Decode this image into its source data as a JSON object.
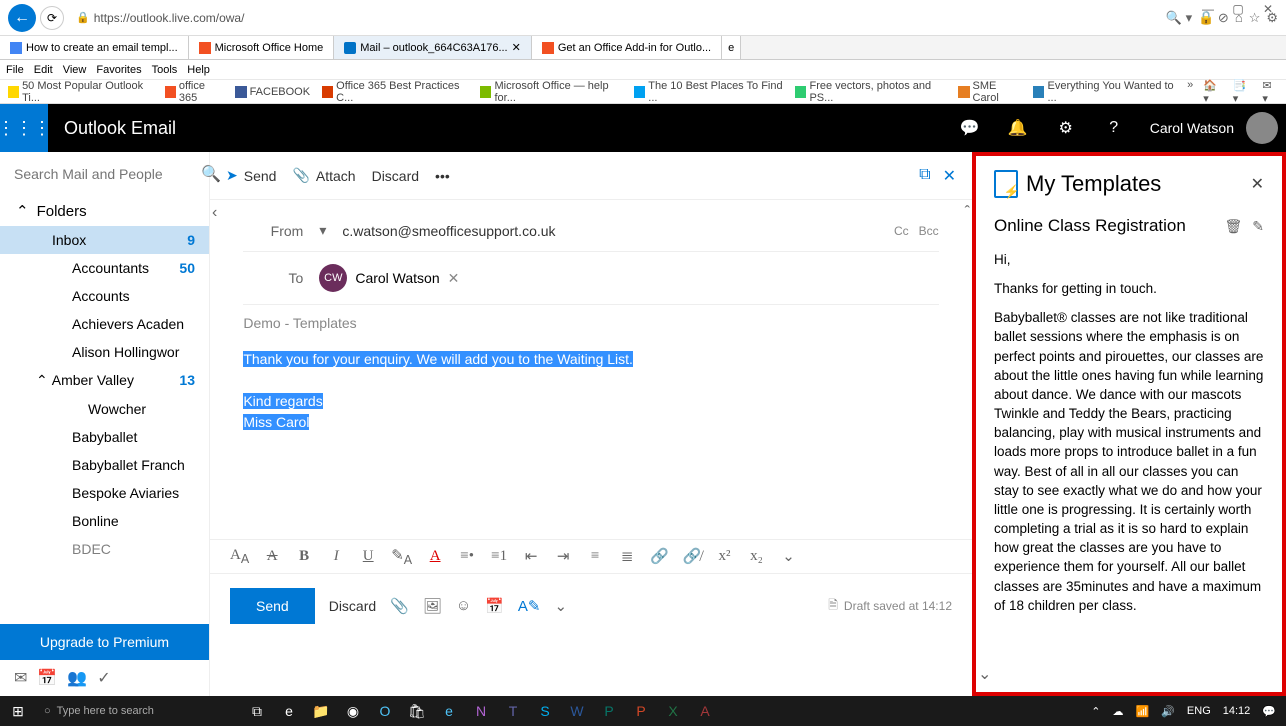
{
  "browser": {
    "url": "https://outlook.live.com/owa/",
    "menus": [
      "File",
      "Edit",
      "View",
      "Favorites",
      "Tools",
      "Help"
    ],
    "tabs": [
      {
        "label": "How to create an email templ..."
      },
      {
        "label": "Microsoft Office Home"
      },
      {
        "label": "Mail – outlook_664C63A176..."
      },
      {
        "label": "Get an Office Add-in for Outlo..."
      }
    ],
    "bookmarks": [
      "50 Most Popular Outlook Ti...",
      "office 365",
      "FACEBOOK",
      "Office 365 Best Practices  C...",
      "Microsoft Office — help for...",
      "The 10 Best Places To Find ...",
      "Free vectors, photos and PS...",
      "SME Carol",
      "Everything You Wanted to ..."
    ]
  },
  "header": {
    "app_title": "Outlook Email",
    "user": "Carol Watson"
  },
  "nav": {
    "search_placeholder": "Search Mail and People",
    "folders_label": "Folders",
    "folders": [
      {
        "name": "Inbox",
        "count": "9",
        "selected": true,
        "indent": 1
      },
      {
        "name": "Accountants",
        "count": "50",
        "indent": 2
      },
      {
        "name": "Accounts",
        "count": "",
        "indent": 2
      },
      {
        "name": "Achievers Academy",
        "count": "",
        "indent": 2,
        "truncated": "Achievers Acaden"
      },
      {
        "name": "Alison Hollingwor",
        "count": "",
        "indent": 2
      },
      {
        "name": "Amber Valley",
        "count": "13",
        "indent": 2,
        "expandable": true
      },
      {
        "name": "Wowcher",
        "count": "",
        "indent": 3
      },
      {
        "name": "Babyballet",
        "count": "",
        "indent": 2
      },
      {
        "name": "Babyballet Franch",
        "count": "",
        "indent": 2
      },
      {
        "name": "Bespoke Aviaries",
        "count": "",
        "indent": 2
      },
      {
        "name": "Bonline",
        "count": "",
        "indent": 2
      },
      {
        "name": "BDEC",
        "count": "",
        "indent": 2
      }
    ],
    "upgrade": "Upgrade to Premium"
  },
  "compose": {
    "send": "Send",
    "attach": "Attach",
    "discard": "Discard",
    "from_label": "From",
    "from_value": "c.watson@smeofficesupport.co.uk",
    "to_label": "To",
    "cc": "Cc",
    "bcc": "Bcc",
    "recipient_name": "Carol Watson",
    "recipient_initials": "CW",
    "subject": "Demo - Templates",
    "body_line1": "Thank you for your enquiry.  We will add you to the Waiting List.",
    "body_line2": "Kind regards",
    "body_line3": "Miss Carol",
    "send_button": "Send",
    "discard_button": "Discard",
    "draft_status": "Draft saved at 14:12"
  },
  "templates": {
    "title": "My Templates",
    "item_name": "Online Class Registration",
    "para1": "Hi,",
    "para2": "Thanks for getting in touch.",
    "para3": "Babyballet® classes are not like traditional ballet sessions where the emphasis is on perfect points and pirouettes, our classes are about the little ones having fun while learning about dance.   We dance with our mascots Twinkle and Teddy the Bears, practicing balancing, play with musical instruments and loads more props to introduce ballet in a fun way.  Best of all in all our classes you can stay to see exactly what we do and how your little one is progressing.  It is certainly worth completing a trial as it is so hard to explain how great the classes are you have to experience them for yourself.  All our ballet classes are 35minutes and have a maximum of 18 children per class."
  },
  "taskbar": {
    "search_placeholder": "Type here to search",
    "lang": "ENG",
    "time": "14:12"
  }
}
